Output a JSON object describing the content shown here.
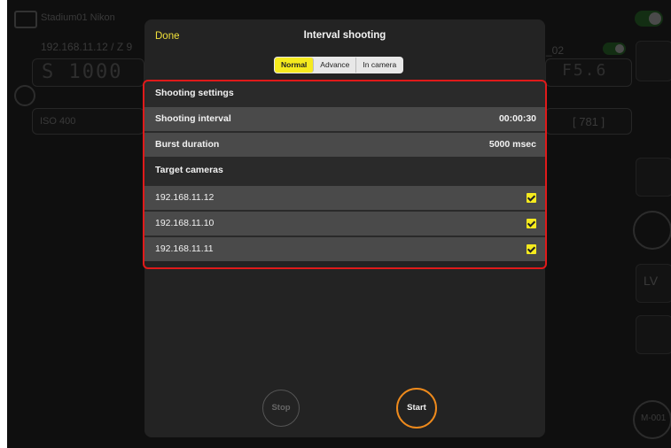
{
  "background": {
    "camera_name": "Stadium01 Nikon",
    "ip_model": "192.168.11.12 / Z 9",
    "shutter_display": "S  1000",
    "exposure_info": "ISO 400",
    "camera_id_right": "_02",
    "aperture_display": "F5.6",
    "shots_remaining": "[ 781 ]",
    "lv_label": "LV",
    "mode_label": "M-001"
  },
  "modal": {
    "done_label": "Done",
    "title": "Interval shooting",
    "tabs": [
      {
        "label": "Normal",
        "active": true
      },
      {
        "label": "Advance",
        "active": false
      },
      {
        "label": "In camera",
        "active": false
      }
    ],
    "shooting_settings": {
      "header": "Shooting settings",
      "rows": [
        {
          "label": "Shooting interval",
          "value": "00:00:30"
        },
        {
          "label": "Burst duration",
          "value": "5000 msec"
        }
      ]
    },
    "target_cameras": {
      "header": "Target cameras",
      "cameras": [
        {
          "ip": "192.168.11.12",
          "checked": true
        },
        {
          "ip": "192.168.11.10",
          "checked": true
        },
        {
          "ip": "192.168.11.11",
          "checked": true
        }
      ]
    },
    "stop_label": "Stop",
    "start_label": "Start"
  },
  "colors": {
    "accent_yellow": "#f5ea1e",
    "start_orange": "#ee8a1c",
    "highlight_red": "#e01a1a"
  }
}
